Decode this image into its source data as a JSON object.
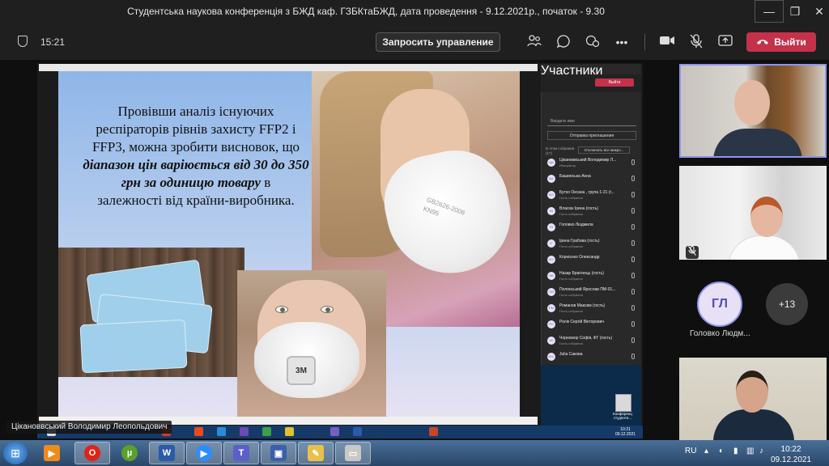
{
  "window": {
    "title": "Студентська наукова конференція з БЖД каф. ГЗБКтаБЖД, дата проведення - 9.12.2021р., початок - 9.30",
    "min": "—",
    "max": "❐",
    "close": "✕"
  },
  "toolbar": {
    "timer": "15:21",
    "request_control": "Запросить управление",
    "leave": "Выйти",
    "icons": [
      "people-icon",
      "chat-icon",
      "reactions-icon",
      "more-icon",
      "camera-icon",
      "mic-off-icon",
      "share-icon"
    ]
  },
  "slide": {
    "line1": "Провівши аналіз існуючих",
    "line2": "респіраторів рівнів захисту FFP2 і",
    "line3": "FFP3, можна зробити висновок, що",
    "emph": "діапазон цін варіюється від 30 до 350 грн за одиницю товару",
    "line_end1": "в",
    "line_end2": "залежності від країни-виробника.",
    "mask_print": "GB2626-2006\nKN95",
    "brand_3m": "3M"
  },
  "participants_panel": {
    "title": "Участники",
    "search_placeholder": "Вводите имя",
    "invite": "Отправка приглашения",
    "in_meeting": "В этом собрании (17)",
    "mute_all": "Отключить все микро...",
    "leave": "Выйти",
    "rows": [
      {
        "initials": "ЦВ",
        "name": "Цікановвський Володимир Л...",
        "role": "Инициатор"
      },
      {
        "initials": "БА",
        "name": "Башинська Анна",
        "role": ""
      },
      {
        "initials": "БО",
        "name": "Бутко Оксана , група 1-21 (г...",
        "role": "Гость собрания"
      },
      {
        "initials": "ВІ",
        "name": "Власюк Ірина (гость)",
        "role": "Гость собрания"
      },
      {
        "initials": "ГЛ",
        "name": "Головко Людмила",
        "role": ""
      },
      {
        "initials": "ІГ",
        "name": "Ірина Грабова (гость)",
        "role": "Гость собрания"
      },
      {
        "initials": "КО",
        "name": "Корнієнко Олександр",
        "role": ""
      },
      {
        "initials": "НБ",
        "name": "Назар Брагінець (гость)",
        "role": "Гость собрания"
      },
      {
        "initials": "ПЯ",
        "name": "Полянський Ярослав ПМ-01...",
        "role": "Гость собрания"
      },
      {
        "initials": "РМ",
        "name": "Романов Максим (гость)",
        "role": "Гость собрания"
      },
      {
        "initials": "РС",
        "name": "Ролік Сергій Вікторович",
        "role": ""
      },
      {
        "initials": "ЧС",
        "name": "Чорномор Софія, ФГ (гость)",
        "role": "Гость собрания"
      },
      {
        "initials": "ЮС",
        "name": "Julia Сакова",
        "role": ""
      }
    ],
    "desktop_icon_label": "Конференц студенти...",
    "inner_clock_time": "10:21",
    "inner_clock_date": "09.12.2021"
  },
  "presenter_name": "Цікановвський Володимир Леопольдович",
  "gallery": {
    "avatar_initials": "ГЛ",
    "avatar_name": "Головко Людм...",
    "more_count": "+13"
  },
  "taskbar": {
    "start": "⊞",
    "lang": "RU",
    "time": "10:22",
    "date": "09.12.2021",
    "apps": [
      "media-player",
      "opera",
      "utorrent",
      "word",
      "zoom",
      "teams",
      "save",
      "paint",
      "drive"
    ]
  }
}
